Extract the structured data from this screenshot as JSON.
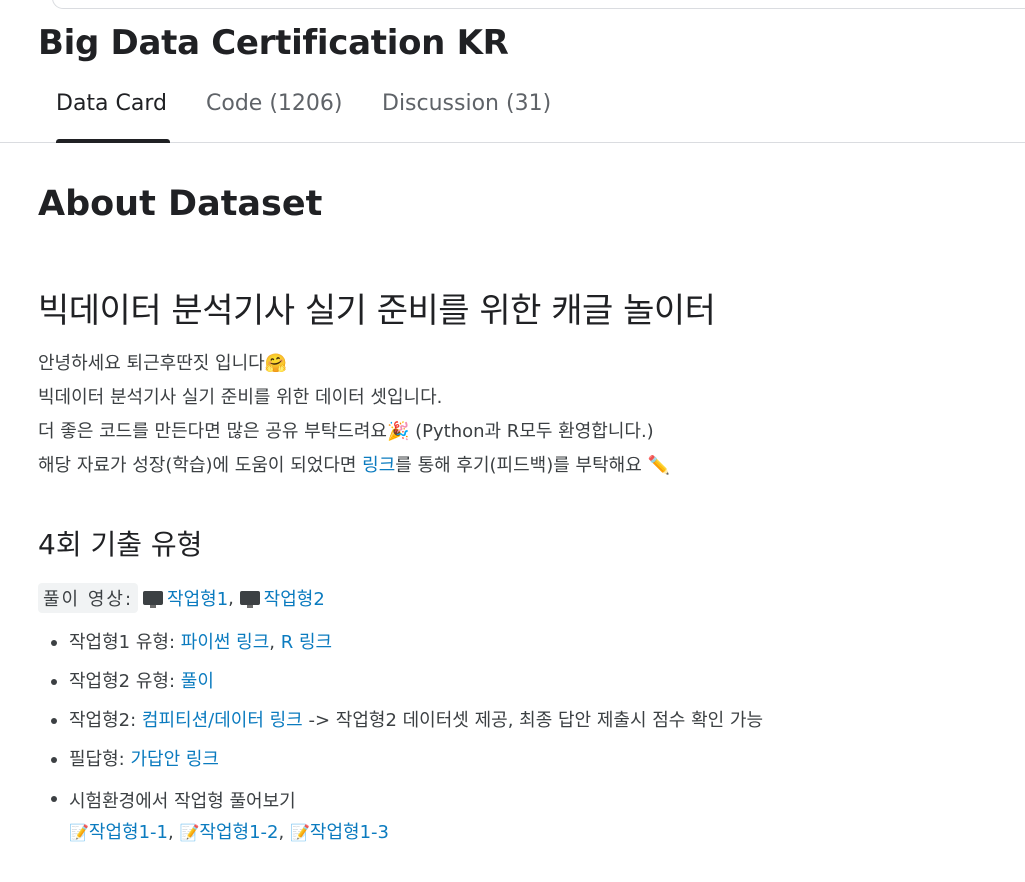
{
  "header": {
    "title": "Big Data Certification KR"
  },
  "tabs": [
    {
      "label": "Data Card",
      "active": true
    },
    {
      "label": "Code (1206)",
      "active": false
    },
    {
      "label": "Discussion (31)",
      "active": false
    }
  ],
  "about": {
    "heading": "About Dataset",
    "main_heading": "빅데이터 분석기사 실기 준비를 위한 캐글 놀이터",
    "intro": {
      "line1": "안녕하세요 퇴근후딴짓 입니다",
      "line1_emoji": "🤗",
      "line2": "빅데이터 분석기사 실기 준비를 위한 데이터 셋입니다.",
      "line3_a": "더 좋은 코드를 만든다면 많은 공유 부탁드려요",
      "line3_emoji": "🎉",
      "line3_b": " (Python과 R모두 환영합니다.)",
      "line4_a": "해당 자료가 성장(학습)에 도움이 되었다면 ",
      "line4_link": "링크",
      "line4_b": "를 통해 후기(피드백)를 부탁해요 ",
      "line4_emoji": "✏️"
    }
  },
  "exam4": {
    "heading": "4회 기출 유형",
    "video_label": "풀이 영상:",
    "video_links": [
      "작업형1",
      "작업형2"
    ],
    "video_icon": "monitor-icon",
    "separator": ",",
    "items": [
      {
        "prefix": "작업형1 유형: ",
        "links": [
          "파이썬 링크",
          "R 링크"
        ],
        "suffix": ""
      },
      {
        "prefix": "작업형2 유형: ",
        "links": [
          "풀이"
        ],
        "suffix": ""
      },
      {
        "prefix": "작업형2: ",
        "links": [
          "컴피티션/데이터 링크"
        ],
        "suffix": " -> 작업형2 데이터셋 제공, 최종 답안 제출시 점수 확인 가능"
      },
      {
        "prefix": "필답형: ",
        "links": [
          "가답안 링크"
        ],
        "suffix": ""
      },
      {
        "prefix": "시험환경에서 작업형 풀어보기",
        "links": [
          "작업형1-1",
          "작업형1-2",
          "작업형1-3"
        ],
        "memo_icon": "memo-icon",
        "memo_emoji": "📝"
      }
    ]
  }
}
